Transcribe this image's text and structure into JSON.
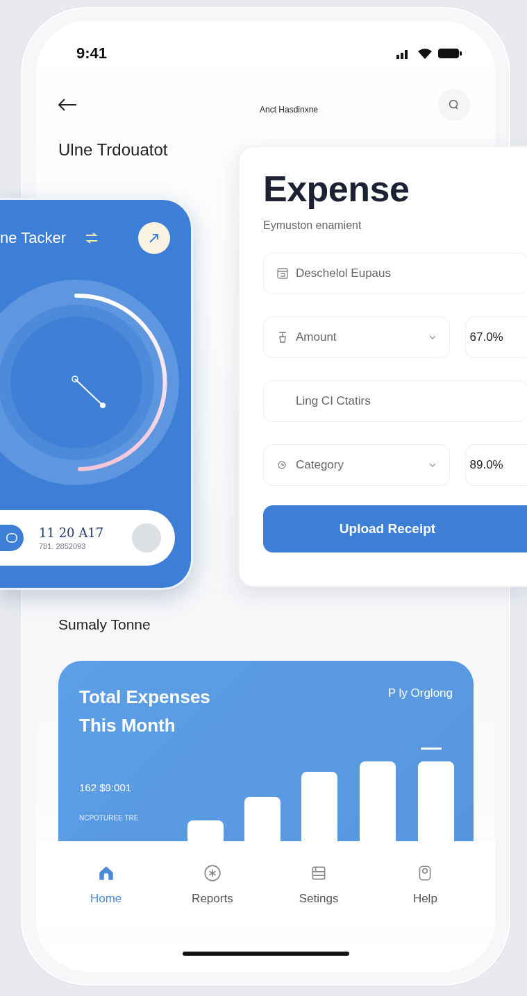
{
  "status_bar": {
    "time": "9:41"
  },
  "header": {
    "label": "Anct Hasdinxne"
  },
  "page_title": "Ulne Trdouatot",
  "tracker_card": {
    "title": "ne Tacker",
    "entry": {
      "value": "11 20 A17",
      "detail": "781. 2852093"
    }
  },
  "expense_card": {
    "title": "Expense",
    "subtitle": "Eymuston enamient",
    "fields": [
      {
        "kind": "text",
        "placeholder": "Deschelol Eupaus"
      },
      {
        "kind": "select",
        "value": "Amount",
        "percent": "67.0%"
      },
      {
        "kind": "text",
        "placeholder": "Ling CI Ctatirs"
      },
      {
        "kind": "select",
        "value": "Category",
        "percent": "89.0%"
      }
    ],
    "button": "Upload Receipt"
  },
  "section_title": "Sumaly Tonne",
  "summary_card": {
    "title": "Total Expenses This Month",
    "link": "P ly Orglong",
    "amount": "162 $9:001",
    "caption": "NCPOTUREE TRE"
  },
  "tab_bar": [
    {
      "label": "Home",
      "selected": true
    },
    {
      "label": "Reports",
      "selected": false
    },
    {
      "label": "Setings",
      "selected": false
    },
    {
      "label": "Help",
      "selected": false
    }
  ]
}
